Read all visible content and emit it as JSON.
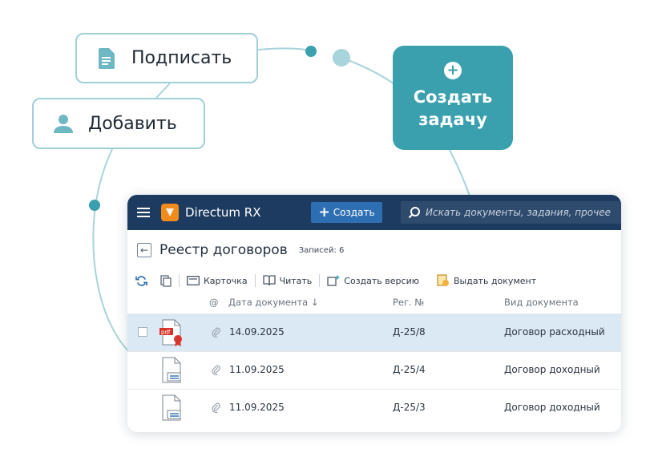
{
  "actions": {
    "sign_label": "Подписать",
    "add_label": "Добавить",
    "create_task_line1": "Создать",
    "create_task_line2": "задачу"
  },
  "app": {
    "name": "Directum RX",
    "create_button_label": "Создать",
    "search_placeholder": "Искать документы, задания, прочее"
  },
  "page": {
    "title": "Реестр договоров",
    "records_count": "Записей: 6"
  },
  "toolbar": {
    "card_label": "Карточка",
    "read_label": "Читать",
    "create_version_label": "Создать версию",
    "issue_document_label": "Выдать документ"
  },
  "grid": {
    "headers": {
      "attach": "@",
      "date": "Дата документа ↓",
      "reg_no": "Рег. №",
      "doc_type": "Вид документа"
    },
    "rows": [
      {
        "date": "14.09.2025",
        "reg_no": "Д-25/8",
        "doc_type": "Договор расходный"
      },
      {
        "date": "11.09.2025",
        "reg_no": "Д-25/4",
        "doc_type": "Договор доходный"
      },
      {
        "date": "11.09.2025",
        "reg_no": "Д-25/3",
        "doc_type": "Договор доходный"
      }
    ]
  },
  "colors": {
    "accent": "#3aa0ae",
    "topbar": "#1d3b60",
    "selected_row": "#dbe9f4",
    "outline": "#9fd0d8"
  }
}
